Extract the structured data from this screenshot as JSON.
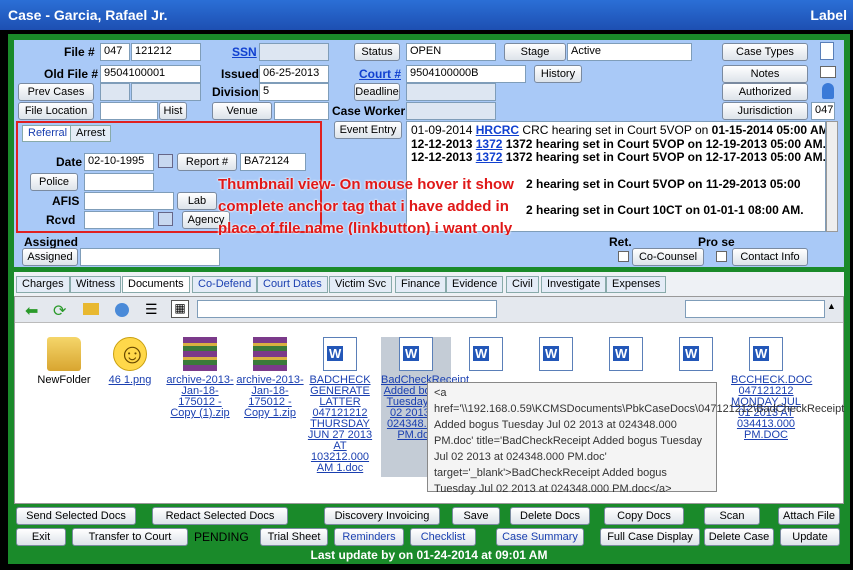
{
  "window": {
    "title": "Case - Garcia, Rafael Jr.",
    "right_label": "Label"
  },
  "header": {
    "file_no_label": "File #",
    "file_no_a": "047",
    "file_no_b": "121212",
    "ssn_link": "SSN",
    "status_btn": "Status",
    "status_val": "OPEN",
    "stage_btn": "Stage",
    "stage_val": "Active",
    "case_types_btn": "Case Types",
    "old_file_label": "Old File #",
    "old_file_val": "9504100001",
    "issued_label": "Issued",
    "issued_val": "06-25-2013",
    "court_link": "Court #",
    "court_val": "9504100000B",
    "history_btn": "History",
    "notes_btn": "Notes",
    "prev_cases_btn": "Prev Cases",
    "division_label": "Division",
    "division_val": "5",
    "deadline_btn": "Deadline",
    "authorized_btn": "Authorized",
    "file_location_btn": "File Location",
    "hist_btn": "Hist",
    "venue_btn": "Venue",
    "jurisdiction_btn": "Jurisdiction",
    "jurisdiction_val": "047",
    "case_worker_label": "Case Worker",
    "event_entry_btn": "Event Entry"
  },
  "referral": {
    "tab_referral": "Referral",
    "tab_arrest": "Arrest",
    "date_label": "Date",
    "date_val": "02-10-1995",
    "report_btn": "Report #",
    "report_val": "BA72124",
    "police_btn": "Police",
    "afis_label": "AFIS",
    "lab_btn": "Lab",
    "rcvd_label": "Rcvd",
    "agency_btn": "Agency"
  },
  "events": [
    {
      "date": "01-09-2014",
      "code": "HRCRC",
      "text": "CRC hearing set in Court 5VOP on",
      "bold": "01-15-2014 05:00 AM."
    },
    {
      "date": "12-12-2013",
      "code": "1372",
      "text": "1372 hearing set in Court 5VOP on 12-19-2013 05:00 AM.",
      "bold": ""
    },
    {
      "date": "12-12-2013",
      "code": "1372",
      "text": "1372 hearing set in Court 5VOP on 12-17-2013 05:00 AM.",
      "bold": ""
    },
    {
      "date": "",
      "code": "",
      "text": "2 hearing set in Court 5VOP on 11-29-2013 05:00",
      "bold": ""
    },
    {
      "date": "",
      "code": "",
      "text": "2 hearing set in Court 10CT on 01-01-1 08:00 AM.",
      "bold": ""
    }
  ],
  "annotation": "Thumbnail view- On mouse hover it show complete anchor tag that i have added in place of file name (linkbutton) i want only file name",
  "assign": {
    "assigned_label": "Assigned",
    "assigned_btn": "Assigned",
    "ret_label": "Ret.",
    "prose_label": "Pro se",
    "cocounsel_btn": "Co-Counsel",
    "contact_btn": "Contact Info"
  },
  "tabs": [
    "Charges",
    "Witness",
    "Documents",
    "Co-Defend",
    "Court Dates",
    "Victim Svc",
    "Finance",
    "Evidence",
    "Civil",
    "Investigate",
    "Expenses"
  ],
  "documents": [
    {
      "name": "NewFolder",
      "kind": "folder"
    },
    {
      "name": "46 1.png",
      "kind": "smiley"
    },
    {
      "name": "archive-2013-Jan-18-175012 - Copy (1).zip",
      "kind": "rar"
    },
    {
      "name": "archive-2013-Jan-18-175012 - Copy 1.zip",
      "kind": "rar"
    },
    {
      "name": "BADCHECK GENERATE LATTER 047121212 THURSDAY JUN 27 2013 AT 103212.000 AM 1.doc",
      "kind": "word"
    },
    {
      "name": "BadCheckReceipt Added bogus Tuesday Jul 02 2013 at 024348.000 PM.doc",
      "kind": "word"
    },
    {
      "name": "",
      "kind": "word"
    },
    {
      "name": "",
      "kind": "word"
    },
    {
      "name": "",
      "kind": "word"
    },
    {
      "name": "",
      "kind": "word"
    },
    {
      "name": "BCCHECK.DOC 047121212 MONDAY JUL 01 2013 AT 034413.000 PM.DOC",
      "kind": "word"
    }
  ],
  "tooltip": "<a href='\\\\192.168.0.59\\KCMSDocuments\\PbkCaseDocs\\047121212\\BadCheckReceipt Added bogus Tuesday Jul 02 2013 at 024348.000 PM.doc' title='BadCheckReceipt Added bogus Tuesday Jul 02 2013 at 024348.000 PM.doc' target='_blank'>BadCheckReceipt Added bogus Tuesday Jul 02 2013 at 024348.000 PM.doc</a>",
  "bottom1": [
    "Send Selected Docs",
    "Redact Selected Docs",
    "Discovery Invoicing",
    "Save",
    "Delete Docs",
    "Copy Docs",
    "Scan",
    "Attach File"
  ],
  "bottom2": {
    "exit": "Exit",
    "transfer": "Transfer to Court",
    "pending": "PENDING",
    "trial": "Trial Sheet",
    "reminders": "Reminders",
    "checklist": "Checklist",
    "summary": "Case Summary",
    "fullcase": "Full Case Display",
    "delete": "Delete Case",
    "update": "Update"
  },
  "status": "Last update by on 01-24-2014 at 09:01 AM"
}
